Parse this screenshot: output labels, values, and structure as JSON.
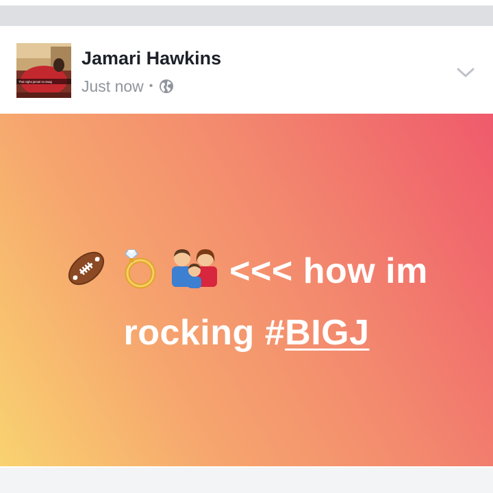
{
  "post": {
    "author": "Jamari Hawkins",
    "timestamp": "Just now",
    "separator": "•",
    "privacy_icon": "globe-icon",
    "menu_icon": "chevron-down-icon",
    "avatar_caption": "That nigha jamari so swag",
    "text_before": "<<< how im",
    "text_line2": "rocking #",
    "hashtag": "BIGJ",
    "emojis": [
      "american-football-icon",
      "ring-icon",
      "family-icon"
    ],
    "background_colors": [
      "#f9d270",
      "#f6a56e",
      "#f38a6e",
      "#ef5a6c"
    ]
  }
}
